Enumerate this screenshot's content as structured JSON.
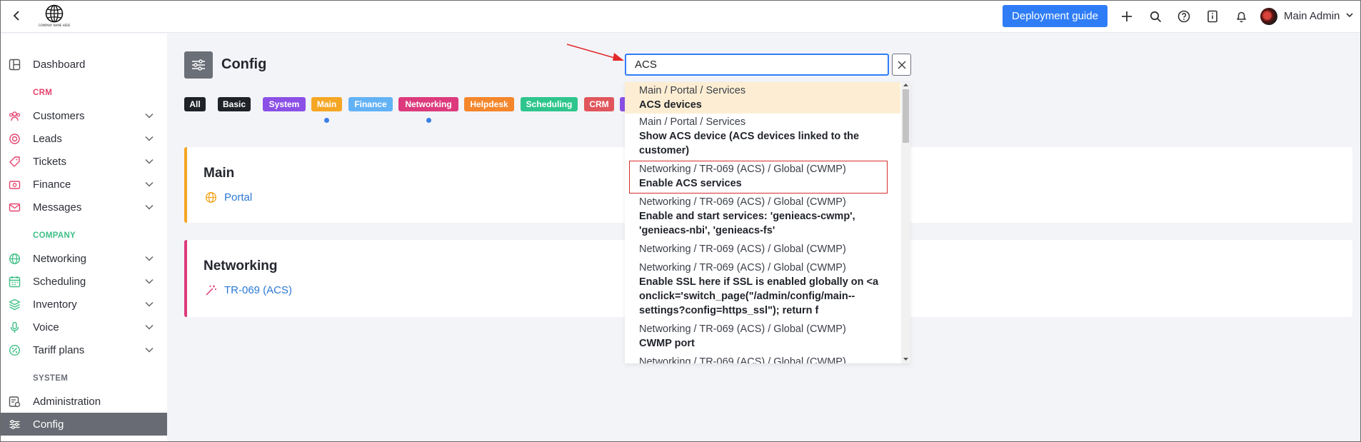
{
  "header": {
    "logo_caption": "COMPANY NAME HERE",
    "deploy_button": "Deployment guide",
    "user_name": "Main Admin"
  },
  "sidebar": {
    "items": [
      {
        "label": "Dashboard",
        "icon": "dashboard-icon"
      },
      {
        "section": "CRM",
        "color": "#e4446f"
      },
      {
        "label": "Customers",
        "icon": "users-icon",
        "chevron": true
      },
      {
        "label": "Leads",
        "icon": "leads-icon",
        "chevron": true
      },
      {
        "label": "Tickets",
        "icon": "ticket-icon",
        "chevron": true
      },
      {
        "label": "Finance",
        "icon": "finance-icon",
        "chevron": true
      },
      {
        "label": "Messages",
        "icon": "envelope-icon",
        "chevron": true
      },
      {
        "section": "COMPANY",
        "color": "#3fbf86"
      },
      {
        "label": "Networking",
        "icon": "globe-icon",
        "chevron": true
      },
      {
        "label": "Scheduling",
        "icon": "calendar-icon",
        "chevron": true
      },
      {
        "label": "Inventory",
        "icon": "layers-icon",
        "chevron": true
      },
      {
        "label": "Voice",
        "icon": "microphone-icon",
        "chevron": true
      },
      {
        "label": "Tariff plans",
        "icon": "tariff-icon",
        "chevron": true
      },
      {
        "section": "SYSTEM",
        "color": "#6b6f78"
      },
      {
        "label": "Administration",
        "icon": "admin-icon"
      },
      {
        "label": "Config",
        "icon": "sliders-icon",
        "active": true
      }
    ]
  },
  "page": {
    "title": "Config"
  },
  "filters": [
    {
      "label": "All",
      "color": "#1f2227"
    },
    {
      "label": "Basic",
      "color": "#1f2227"
    },
    {
      "label": "System",
      "color": "#8b50e6"
    },
    {
      "label": "Main",
      "color": "#f5a623"
    },
    {
      "label": "Finance",
      "color": "#63b2f5"
    },
    {
      "label": "Networking",
      "color": "#dc3a7c"
    },
    {
      "label": "Helpdesk",
      "color": "#f4862b"
    },
    {
      "label": "Scheduling",
      "color": "#2ec58c"
    },
    {
      "label": "CRM",
      "color": "#e0565c"
    }
  ],
  "cards": [
    {
      "title": "Main",
      "link": "Portal",
      "color": "#f5a623"
    },
    {
      "title": "Networking",
      "link": "TR-069 (ACS)",
      "color": "#dc3a7c"
    }
  ],
  "search": {
    "value": "ACS"
  },
  "results": [
    {
      "path": "Main / Portal / Services",
      "title": "ACS devices"
    },
    {
      "path": "Main / Portal / Services",
      "title": "Show ACS device (ACS devices linked to the customer)"
    },
    {
      "path": "Networking / TR-069 (ACS) / Global (CWMP)",
      "title": "Enable ACS services"
    },
    {
      "path": "Networking / TR-069 (ACS) / Global (CWMP)",
      "title": "Enable and start services: 'genieacs-cwmp', 'genieacs-nbi', 'genieacs-fs'"
    },
    {
      "path": "Networking / TR-069 (ACS) / Global (CWMP)",
      "title": ""
    },
    {
      "path": "Networking / TR-069 (ACS) / Global (CWMP)",
      "title": "Enable SSL here if SSL is enabled globally on <a onclick='switch_page(\"/admin/config/main--settings?config=https_ssl\"); return f"
    },
    {
      "path": "Networking / TR-069 (ACS) / Global (CWMP)",
      "title": "CWMP port"
    },
    {
      "path": "Networking / TR-069 (ACS) / Global (CWMP)",
      "title": ""
    }
  ]
}
